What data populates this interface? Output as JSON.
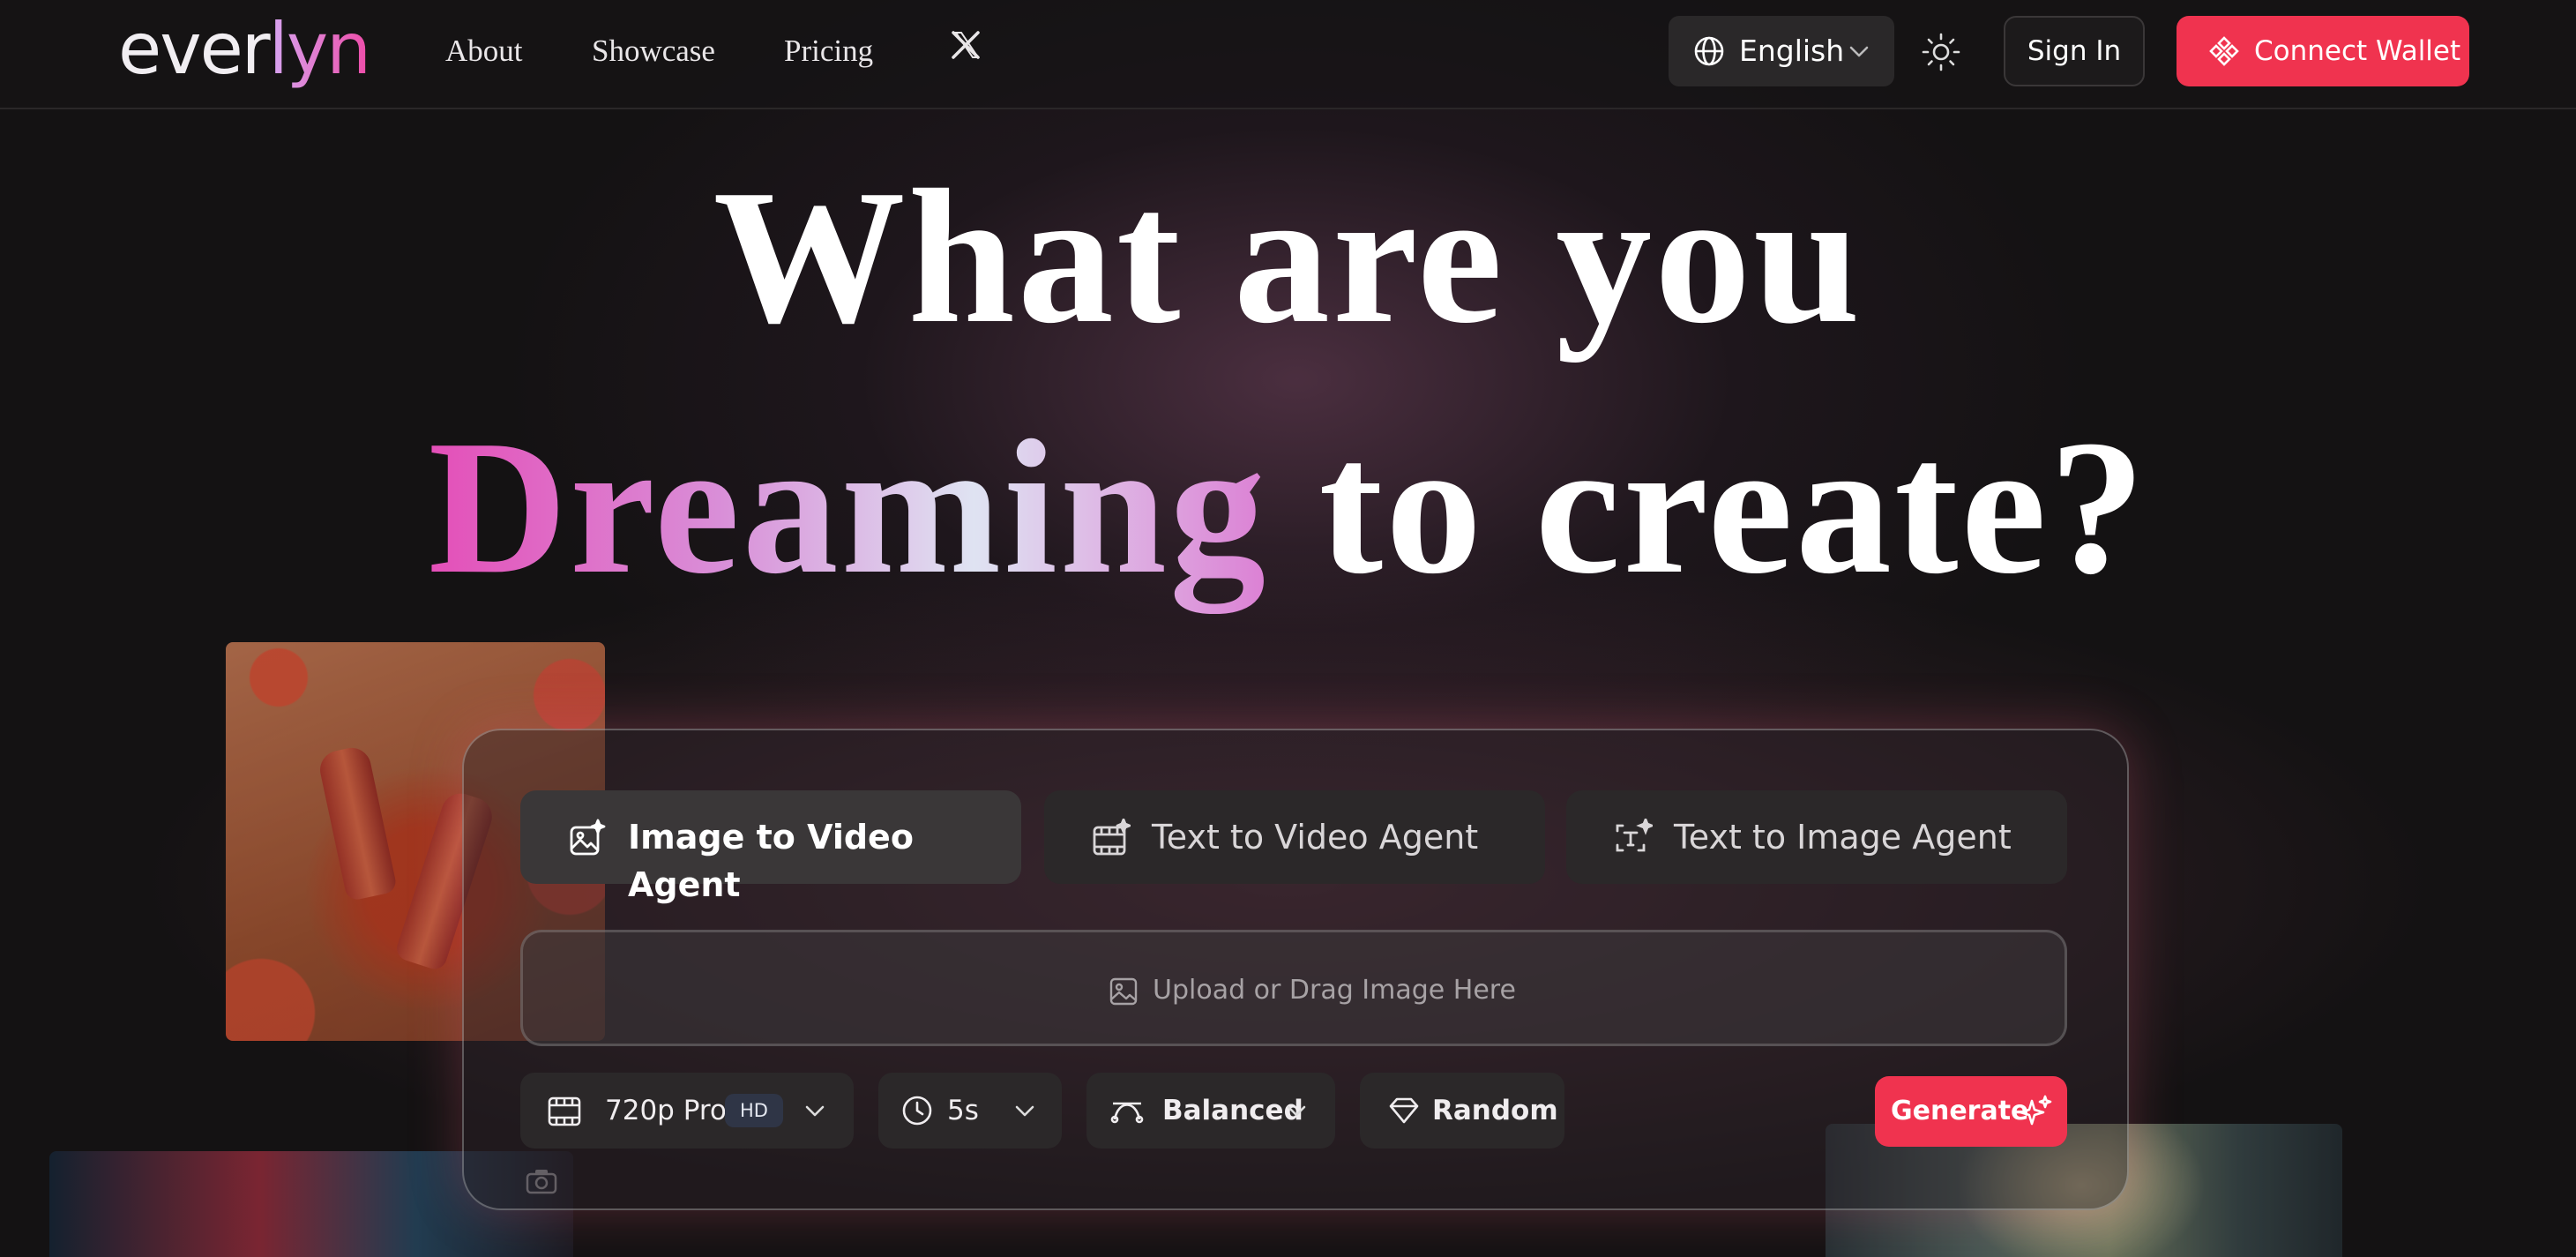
{
  "brand": {
    "logo_text_a": "ever",
    "logo_text_b": "lyn"
  },
  "nav": {
    "about": "About",
    "showcase": "Showcase",
    "pricing": "Pricing",
    "x_icon": "x-twitter-icon"
  },
  "header_actions": {
    "language": "English",
    "theme_icon": "sun-icon",
    "sign_in": "Sign In",
    "connect_wallet": "Connect Wallet"
  },
  "hero": {
    "line1": "What are you",
    "highlight": "Dreaming",
    "line2_rest": " to create?"
  },
  "tabs": [
    {
      "label": "Image to Video Agent",
      "icon": "image-sparkle-icon",
      "active": true
    },
    {
      "label": "Text to Video Agent",
      "icon": "film-sparkle-icon",
      "active": false
    },
    {
      "label": "Text to Image Agent",
      "icon": "text-sparkle-icon",
      "active": false
    }
  ],
  "upload": {
    "label": "Upload or Drag Image Here",
    "icon": "image-icon"
  },
  "options": {
    "quality": "720p Pro",
    "quality_badge": "HD",
    "duration": "5s",
    "motion": "Balanced",
    "seed": "Random"
  },
  "generate": {
    "label": "Generate",
    "icon": "sparkles-icon"
  },
  "colors": {
    "accent": "#f0334f",
    "background": "#141213",
    "panel": "#2b2829",
    "gradient_start": "#e44fb8",
    "gradient_end": "#dfe3f2"
  }
}
